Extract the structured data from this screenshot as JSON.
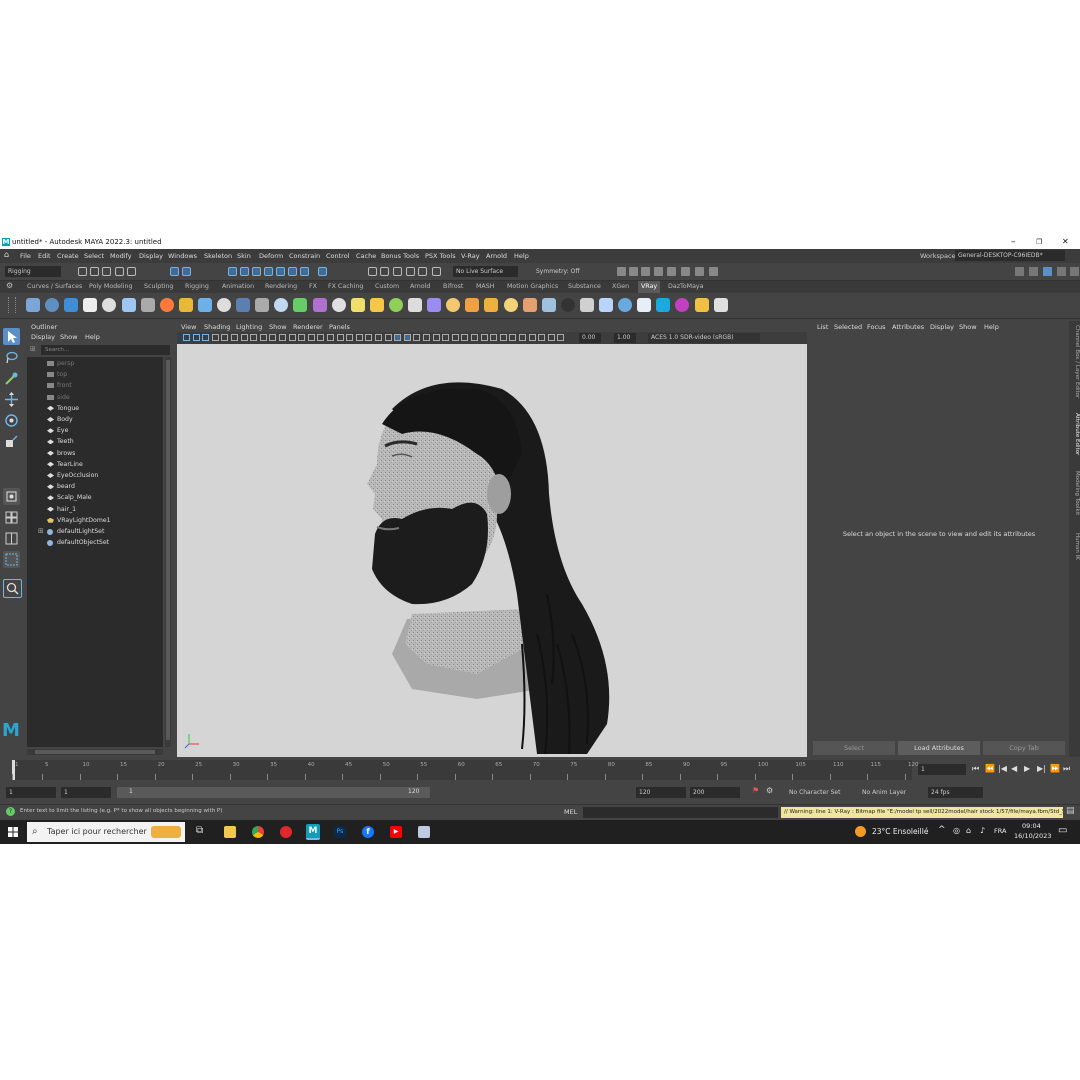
{
  "window": {
    "title": "untitled* - Autodesk MAYA 2022.3: untitled",
    "min": "–",
    "max": "❐",
    "close": "✕"
  },
  "menu": {
    "items": [
      "File",
      "Edit",
      "Create",
      "Select",
      "Modify",
      "Display",
      "Windows",
      "Skeleton",
      "Skin",
      "Deform",
      "Constrain",
      "Control",
      "Cache",
      "Bonus Tools",
      "PSX Tools",
      "V-Ray",
      "Arnold",
      "Help"
    ],
    "workspace_label": "Workspace:",
    "workspace_value": "General-DESKTOP-C96IEDB*"
  },
  "statusline": {
    "mode": "Rigging",
    "live_surface": "No Live Surface",
    "symmetry": "Symmetry: Off"
  },
  "shelf_tabs": [
    "Curves / Surfaces",
    "Poly Modeling",
    "Sculpting",
    "Rigging",
    "Animation",
    "Rendering",
    "FX",
    "FX Caching",
    "Custom",
    "Arnold",
    "Bifrost",
    "MASH",
    "Motion Graphics",
    "Substance",
    "XGen",
    "VRay",
    "DazToMaya"
  ],
  "shelf_active": "VRay",
  "outliner": {
    "title": "Outliner",
    "menu": [
      "Display",
      "Show",
      "Help"
    ],
    "search_placeholder": "Search...",
    "items": [
      {
        "label": "persp",
        "kind": "camera",
        "dim": true
      },
      {
        "label": "top",
        "kind": "camera",
        "dim": true
      },
      {
        "label": "front",
        "kind": "camera",
        "dim": true
      },
      {
        "label": "side",
        "kind": "camera",
        "dim": true
      },
      {
        "label": "Tongue",
        "kind": "mesh",
        "dim": false
      },
      {
        "label": "Body",
        "kind": "mesh",
        "dim": false
      },
      {
        "label": "Eye",
        "kind": "mesh",
        "dim": false
      },
      {
        "label": "Teeth",
        "kind": "mesh",
        "dim": false
      },
      {
        "label": "brows",
        "kind": "mesh",
        "dim": false
      },
      {
        "label": "TearLine",
        "kind": "mesh",
        "dim": false
      },
      {
        "label": "EyeOcclusion",
        "kind": "mesh",
        "dim": false
      },
      {
        "label": "beard",
        "kind": "mesh",
        "dim": false
      },
      {
        "label": "Scalp_Male",
        "kind": "mesh",
        "dim": false
      },
      {
        "label": "hair_1",
        "kind": "mesh",
        "dim": false
      },
      {
        "label": "VRayLightDome1",
        "kind": "light",
        "dim": false
      },
      {
        "label": "defaultLightSet",
        "kind": "set",
        "dim": false
      },
      {
        "label": "defaultObjectSet",
        "kind": "set",
        "dim": false
      }
    ]
  },
  "viewport": {
    "menu": [
      "View",
      "Shading",
      "Lighting",
      "Show",
      "Renderer",
      "Panels"
    ],
    "exposure": "0.00",
    "gamma": "1.00",
    "color_space": "ACES 1.0 SDR-video (sRGB)"
  },
  "attribute_editor": {
    "menu": [
      "List",
      "Selected",
      "Focus",
      "Attributes",
      "Display",
      "Show",
      "Help"
    ],
    "message": "Select an object in the scene to view and edit its attributes",
    "buttons": [
      "Select",
      "Load Attributes",
      "Copy Tab"
    ]
  },
  "side_tabs": [
    "Channel Box / Layer Editor",
    "Attribute Editor",
    "Modeling Toolkit",
    "Human IK"
  ],
  "timeline": {
    "ticks": [
      "1",
      "5",
      "10",
      "15",
      "20",
      "25",
      "30",
      "35",
      "40",
      "45",
      "50",
      "55",
      "60",
      "65",
      "70",
      "75",
      "80",
      "85",
      "90",
      "95",
      "100",
      "105",
      "110",
      "115",
      "120"
    ],
    "current_frame": "1"
  },
  "range": {
    "start": "1",
    "start_inner": "1",
    "slider_start": "1",
    "slider_end": "120",
    "end_inner": "120",
    "end": "200",
    "character_set": "No Character Set",
    "anim_layer": "No Anim Layer",
    "fps": "24 fps"
  },
  "command": {
    "help_text": "Enter text to limit the listing (e.g. P* to show all objects beginning with P)",
    "lang": "MEL",
    "warning": "// Warning: line 1: V-Ray : Bitmap file \"E:/model tp sell/2022model/hair stock 1/57/file/maya.fbm/Std_Skin_Head_Nor"
  },
  "taskbar": {
    "search_placeholder": "Taper ici pour rechercher",
    "weather": "23°C  Ensoleillé",
    "lang": "FRA",
    "time": "09:04",
    "date": "16/10/2023"
  },
  "colors": {
    "accent": "#5a8fc8",
    "maya_teal": "#0aa0b8",
    "warning_bg": "#f0e6a0"
  }
}
